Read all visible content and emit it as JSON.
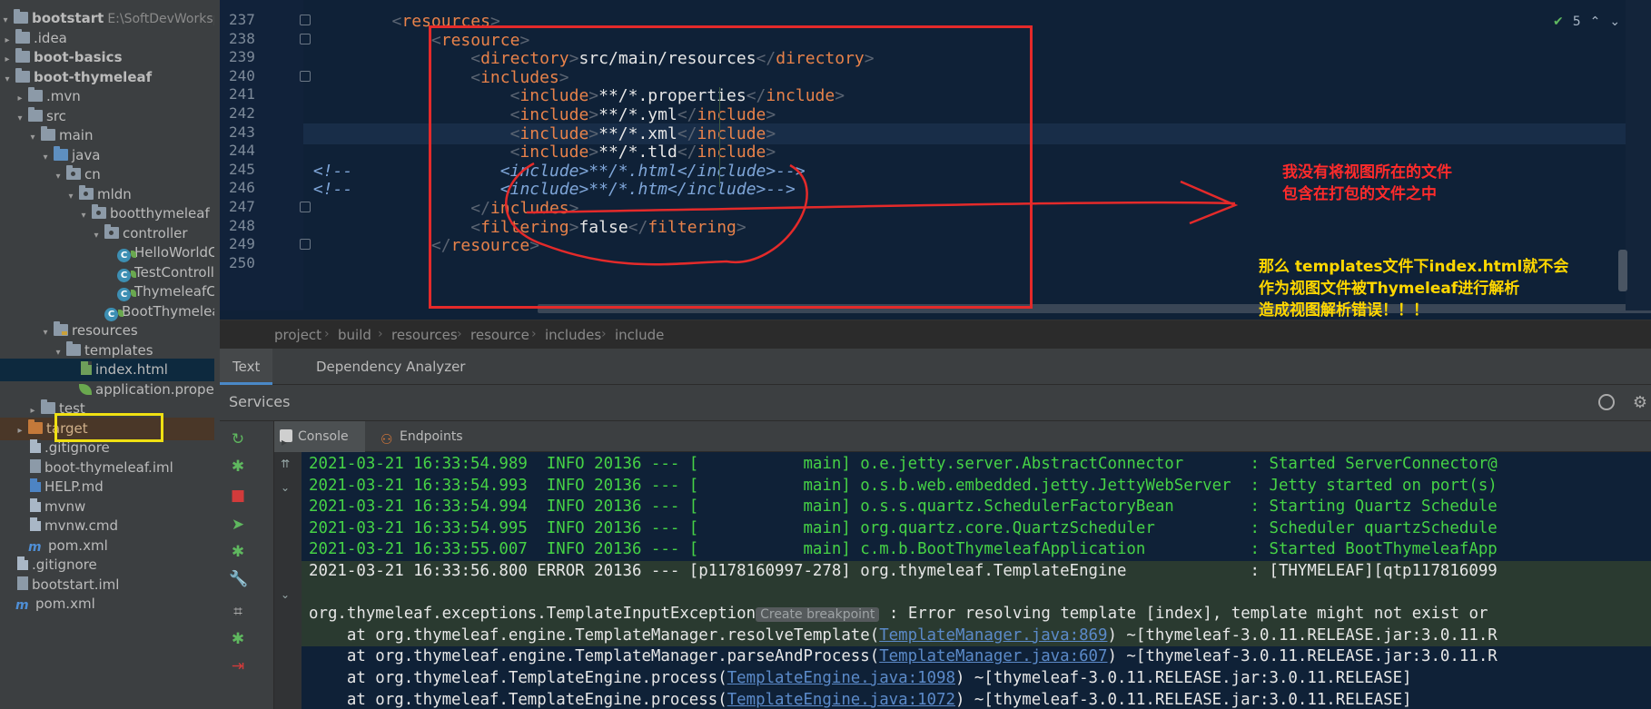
{
  "project_tree": {
    "root": {
      "label": "bootstart",
      "path": "E:\\SoftDevWorkspa"
    },
    "items": [
      {
        "label": ".idea",
        "depth": 0,
        "arrow": "right",
        "icon": "folder-icon",
        "bold": false
      },
      {
        "label": "boot-basics",
        "depth": 0,
        "arrow": "right",
        "icon": "folder-icon",
        "bold": true
      },
      {
        "label": "boot-thymeleaf",
        "depth": 0,
        "arrow": "down",
        "icon": "folder-icon",
        "bold": true
      },
      {
        "label": ".mvn",
        "depth": 1,
        "arrow": "right",
        "icon": "folder-icon",
        "bold": false
      },
      {
        "label": "src",
        "depth": 1,
        "arrow": "down",
        "icon": "folder-icon",
        "bold": false
      },
      {
        "label": "main",
        "depth": 2,
        "arrow": "down",
        "icon": "folder-icon",
        "bold": false
      },
      {
        "label": "java",
        "depth": 3,
        "arrow": "down",
        "icon": "source-folder-icon",
        "bold": false
      },
      {
        "label": "cn",
        "depth": 4,
        "arrow": "down",
        "icon": "package-icon",
        "bold": false
      },
      {
        "label": "mldn",
        "depth": 5,
        "arrow": "down",
        "icon": "package-icon",
        "bold": false
      },
      {
        "label": "bootthymeleaf",
        "depth": 6,
        "arrow": "down",
        "icon": "package-icon",
        "bold": false
      },
      {
        "label": "controller",
        "depth": 7,
        "arrow": "down",
        "icon": "package-icon",
        "bold": false
      },
      {
        "label": "HelloWorldCont",
        "depth": 8,
        "arrow": "",
        "icon": "spring-class-icon",
        "bold": false
      },
      {
        "label": "TestController",
        "depth": 8,
        "arrow": "",
        "icon": "spring-class-icon",
        "bold": false
      },
      {
        "label": "ThymeleafContr",
        "depth": 8,
        "arrow": "",
        "icon": "spring-class-icon",
        "bold": false
      },
      {
        "label": "BootThymeleafAp",
        "depth": 7,
        "arrow": "",
        "icon": "spring-boot-class-icon",
        "bold": false
      },
      {
        "label": "resources",
        "depth": 3,
        "arrow": "down",
        "icon": "resources-folder-icon",
        "bold": false
      },
      {
        "label": "templates",
        "depth": 4,
        "arrow": "down",
        "icon": "folder-icon",
        "bold": false
      },
      {
        "label": "index.html",
        "depth": 5,
        "arrow": "",
        "icon": "html-file-icon",
        "bold": false,
        "selected": true
      },
      {
        "label": "application.properties",
        "depth": 5,
        "arrow": "",
        "icon": "properties-leaf-icon",
        "bold": false
      },
      {
        "label": "test",
        "depth": 2,
        "arrow": "right",
        "icon": "folder-icon",
        "bold": false
      },
      {
        "label": "target",
        "depth": 1,
        "arrow": "right",
        "icon": "excluded-folder-icon",
        "bold": false,
        "excluded": true
      },
      {
        "label": ".gitignore",
        "depth": 1,
        "arrow": "",
        "icon": "file-icon",
        "bold": false
      },
      {
        "label": "boot-thymeleaf.iml",
        "depth": 1,
        "arrow": "",
        "icon": "iml-file-icon",
        "bold": false
      },
      {
        "label": "HELP.md",
        "depth": 1,
        "arrow": "",
        "icon": "markdown-file-icon",
        "bold": false
      },
      {
        "label": "mvnw",
        "depth": 1,
        "arrow": "",
        "icon": "file-icon",
        "bold": false
      },
      {
        "label": "mvnw.cmd",
        "depth": 1,
        "arrow": "",
        "icon": "file-icon",
        "bold": false
      },
      {
        "label": "pom.xml",
        "depth": 1,
        "arrow": "",
        "icon": "maven-pom-icon",
        "bold": false
      },
      {
        "label": ".gitignore",
        "depth": 0,
        "arrow": "",
        "icon": "file-icon",
        "bold": false
      },
      {
        "label": "bootstart.iml",
        "depth": 0,
        "arrow": "",
        "icon": "iml-file-icon",
        "bold": false
      },
      {
        "label": "pom.xml",
        "depth": 0,
        "arrow": "",
        "icon": "maven-pom-icon",
        "bold": false
      }
    ]
  },
  "editor": {
    "first_line": 237,
    "current_line": 243,
    "lines": [
      {
        "num": "237",
        "tokens": [
          [
            "b",
            "<"
          ],
          [
            "t",
            "resources"
          ],
          [
            "b",
            ">"
          ]
        ],
        "indent": 8
      },
      {
        "num": "238",
        "tokens": [
          [
            "b",
            "<"
          ],
          [
            "t",
            "resource"
          ],
          [
            "b",
            ">"
          ]
        ],
        "indent": 12
      },
      {
        "num": "239",
        "tokens": [
          [
            "b",
            "<"
          ],
          [
            "t",
            "directory"
          ],
          [
            "b",
            ">"
          ],
          [
            "x",
            "src/main/resources"
          ],
          [
            "b",
            "</"
          ],
          [
            "t",
            "directory"
          ],
          [
            "b",
            ">"
          ]
        ],
        "indent": 16
      },
      {
        "num": "240",
        "tokens": [
          [
            "b",
            "<"
          ],
          [
            "t",
            "includes"
          ],
          [
            "b",
            ">"
          ]
        ],
        "indent": 16
      },
      {
        "num": "241",
        "tokens": [
          [
            "b",
            "<"
          ],
          [
            "t",
            "include"
          ],
          [
            "b",
            ">"
          ],
          [
            "x",
            "**/*.properties"
          ],
          [
            "b",
            "</"
          ],
          [
            "t",
            "include"
          ],
          [
            "b",
            ">"
          ]
        ],
        "indent": 20
      },
      {
        "num": "242",
        "tokens": [
          [
            "b",
            "<"
          ],
          [
            "t",
            "include"
          ],
          [
            "b",
            ">"
          ],
          [
            "x",
            "**/*.yml"
          ],
          [
            "b",
            "</"
          ],
          [
            "t",
            "include"
          ],
          [
            "b",
            ">"
          ]
        ],
        "indent": 20
      },
      {
        "num": "243",
        "tokens": [
          [
            "b",
            "<"
          ],
          [
            "t",
            "include"
          ],
          [
            "b",
            ">"
          ],
          [
            "x",
            "**/*.xml"
          ],
          [
            "b",
            "</"
          ],
          [
            "t",
            "include"
          ],
          [
            "b",
            ">"
          ]
        ],
        "indent": 20
      },
      {
        "num": "244",
        "tokens": [
          [
            "b",
            "<"
          ],
          [
            "t",
            "include"
          ],
          [
            "b",
            ">"
          ],
          [
            "x",
            "**/*.tld"
          ],
          [
            "b",
            "</"
          ],
          [
            "t",
            "include"
          ],
          [
            "b",
            ">"
          ]
        ],
        "indent": 20
      },
      {
        "num": "245",
        "tokens": [
          [
            "c",
            "<!--"
          ],
          [
            "s",
            "               "
          ],
          [
            "c",
            "<include>**/*.html</include>-->"
          ]
        ],
        "indent": 0
      },
      {
        "num": "246",
        "tokens": [
          [
            "c",
            "<!--"
          ],
          [
            "s",
            "               "
          ],
          [
            "c",
            "<include>**/*.htm</include>-->"
          ]
        ],
        "indent": 0
      },
      {
        "num": "247",
        "tokens": [
          [
            "b",
            "</"
          ],
          [
            "t",
            "includes"
          ],
          [
            "b",
            ">"
          ]
        ],
        "indent": 16
      },
      {
        "num": "248",
        "tokens": [
          [
            "b",
            "<"
          ],
          [
            "t",
            "filtering"
          ],
          [
            "b",
            ">"
          ],
          [
            "x",
            "false"
          ],
          [
            "b",
            "</"
          ],
          [
            "t",
            "filtering"
          ],
          [
            "b",
            ">"
          ]
        ],
        "indent": 16
      },
      {
        "num": "249",
        "tokens": [
          [
            "b",
            "</"
          ],
          [
            "t",
            "resource"
          ],
          [
            "b",
            ">"
          ]
        ],
        "indent": 12
      },
      {
        "num": "250",
        "tokens": [],
        "indent": 0
      }
    ],
    "inspection": {
      "count": "5"
    }
  },
  "breadcrumb": [
    "project",
    "build",
    "resources",
    "resource",
    "includes",
    "include"
  ],
  "editor_tabs": [
    {
      "label": "Text",
      "active": true
    },
    {
      "label": "Dependency Analyzer",
      "active": false
    }
  ],
  "services": {
    "title": "Services",
    "tabs": [
      {
        "label": "Console",
        "active": true
      },
      {
        "label": "Endpoints",
        "active": false
      }
    ]
  },
  "console_lines": [
    {
      "kind": "info",
      "text": "2021-03-21 16:33:54.989  INFO 20136 --- [           main] o.e.jetty.server.AbstractConnector       : Started ServerConnector@"
    },
    {
      "kind": "info",
      "text": "2021-03-21 16:33:54.993  INFO 20136 --- [           main] o.s.b.web.embedded.jetty.JettyWebServer  : Jetty started on port(s)"
    },
    {
      "kind": "info",
      "text": "2021-03-21 16:33:54.994  INFO 20136 --- [           main] o.s.s.quartz.SchedulerFactoryBean        : Starting Quartz Schedule"
    },
    {
      "kind": "info",
      "text": "2021-03-21 16:33:54.995  INFO 20136 --- [           main] org.quartz.core.QuartzScheduler          : Scheduler quartzSchedule"
    },
    {
      "kind": "info",
      "text": "2021-03-21 16:33:55.007  INFO 20136 --- [           main] c.m.b.BootThymeleafApplication           : Started BootThymeleafApp"
    },
    {
      "kind": "error",
      "text": "2021-03-21 16:33:56.800 ERROR 20136 --- [p1178160997-278] org.thymeleaf.TemplateEngine             : [THYMELEAF][qtp117816099"
    },
    {
      "kind": "blank",
      "text": ""
    },
    {
      "kind": "exception",
      "pre": "org.thymeleaf.exceptions.TemplateInputException",
      "chip": "Create breakpoint",
      "post": " : Error resolving template [index], template might not exist or"
    },
    {
      "kind": "trace",
      "pre": "    at org.thymeleaf.engine.TemplateManager.resolveTemplate(",
      "link": "TemplateManager.java:869",
      "post": ") ~[thymeleaf-3.0.11.RELEASE.jar:3.0.11.R",
      "hl": true
    },
    {
      "kind": "trace",
      "pre": "    at org.thymeleaf.engine.TemplateManager.parseAndProcess(",
      "link": "TemplateManager.java:607",
      "post": ") ~[thymeleaf-3.0.11.RELEASE.jar:3.0.11.R",
      "hl": false
    },
    {
      "kind": "trace",
      "pre": "    at org.thymeleaf.TemplateEngine.process(",
      "link": "TemplateEngine.java:1098",
      "post": ") ~[thymeleaf-3.0.11.RELEASE.jar:3.0.11.RELEASE]",
      "hl": false
    },
    {
      "kind": "trace",
      "pre": "    at org.thymeleaf.TemplateEngine.process(",
      "link": "TemplateEngine.java:1072",
      "post": ") ~[thymeleaf-3.0.11.RELEASE.jar:3.0.11.RELEASE]",
      "hl": false
    }
  ],
  "annotations": {
    "red_note_line1": "我没有将视图所在的文件",
    "red_note_line2": "包含在打包的文件之中",
    "yellow_note_line1": "那么 templates文件下index.html就不会",
    "yellow_note_line2": "作为视图文件被Thymeleaf进行解析",
    "yellow_note_line3": "造成视图解析错误！！！"
  },
  "colors": {
    "annotation_red": "#ff2b2b",
    "annotation_yellow": "#ffd700",
    "xml_tag": "#e8824a",
    "xml_comment": "#7fa6d9",
    "log_info": "#46d246",
    "editor_bg": "#0f2137"
  }
}
